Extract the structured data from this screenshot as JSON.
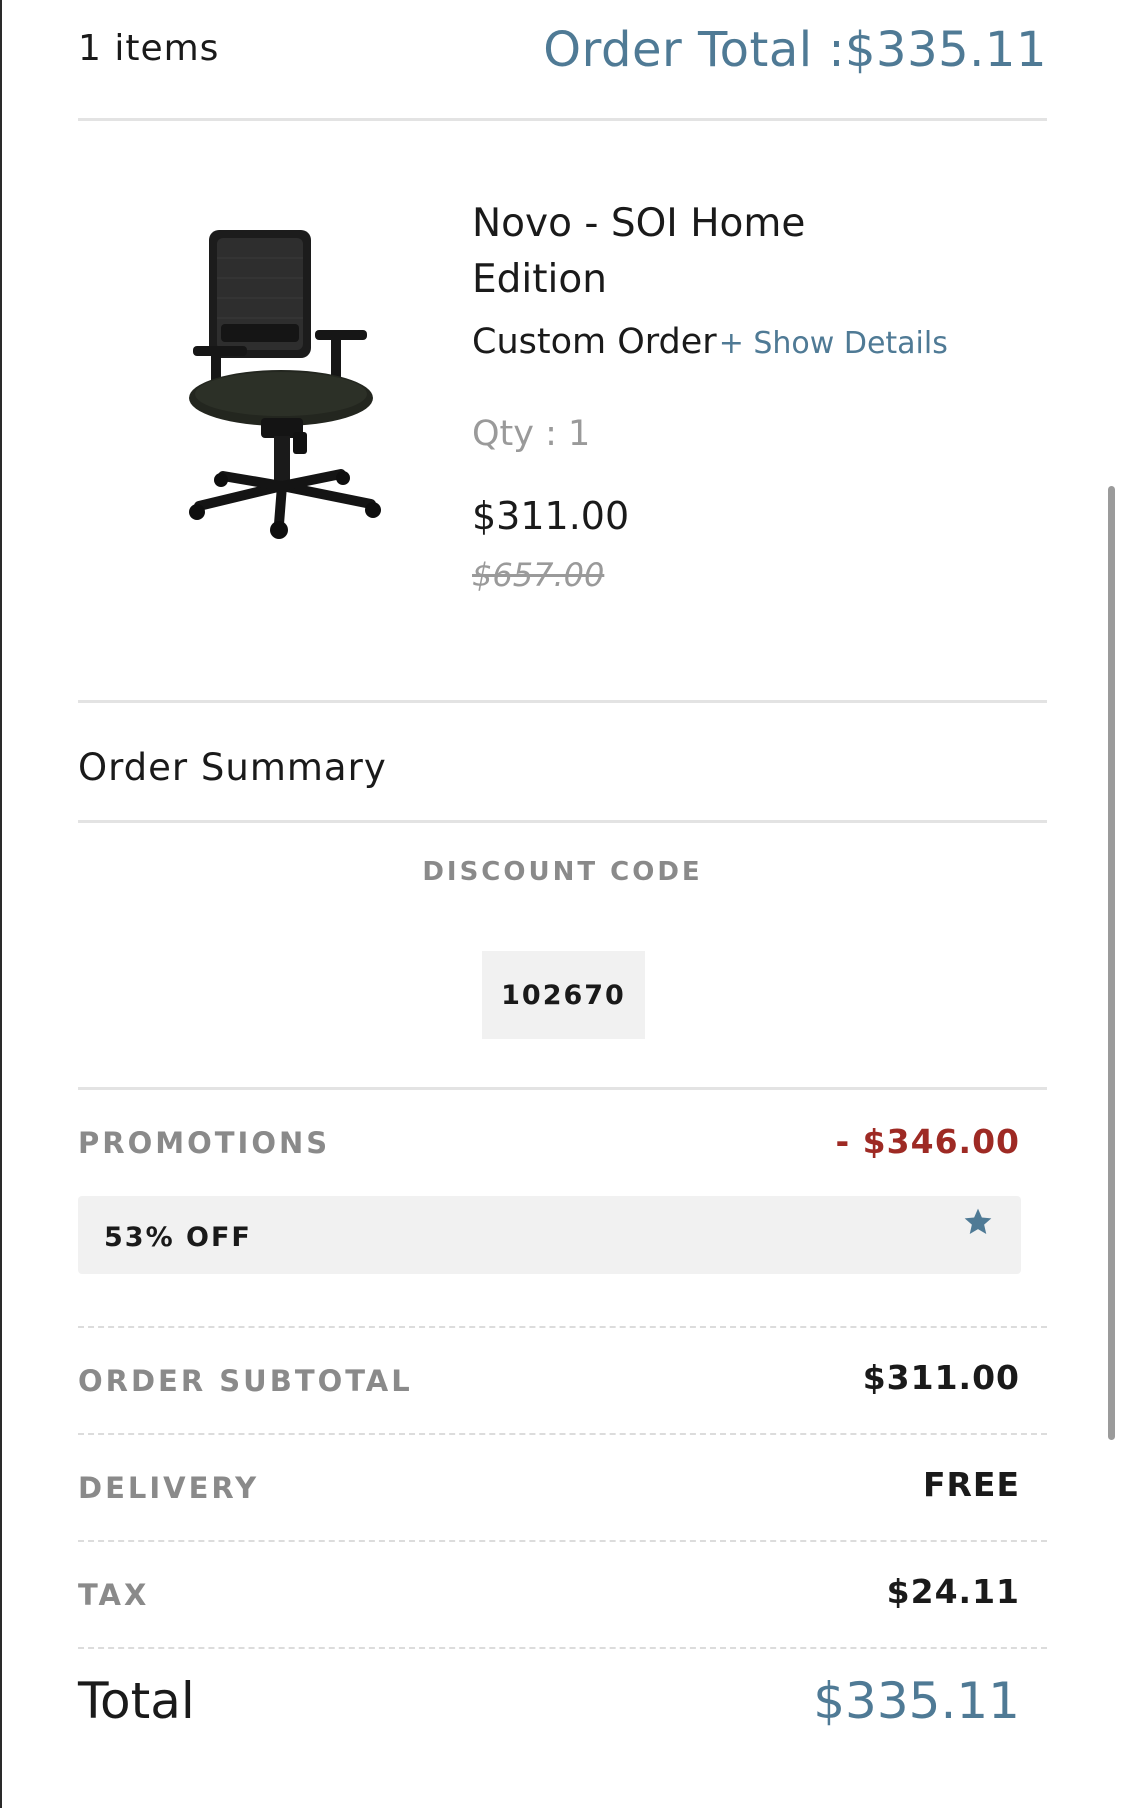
{
  "header": {
    "items_count": "1  items",
    "order_total_label": "Order Total :",
    "order_total_value": "$335.11"
  },
  "product": {
    "name": "Novo - SOI Home Edition",
    "subtitle": "Custom Order",
    "show_details": "+ Show Details",
    "qty": "Qty : 1",
    "price": "$311.00",
    "original_price": "$657.00",
    "image_icon": "office-chair"
  },
  "summary": {
    "title": "Order Summary",
    "discount_label": "DISCOUNT CODE",
    "discount_code": "102670",
    "promotions_label": "PROMOTIONS",
    "promotions_value": "- $346.00",
    "promo_chip": "53% OFF",
    "promo_icon": "star-icon",
    "subtotal_label": "ORDER SUBTOTAL",
    "subtotal_value": "$311.00",
    "delivery_label": "DELIVERY",
    "delivery_value": "FREE",
    "tax_label": "TAX",
    "tax_value": "$24.11",
    "total_label": "Total",
    "total_value": "$335.11"
  },
  "colors": {
    "accent": "#4f7a95",
    "promo_red": "#9e2a24",
    "muted": "#8a8a8a"
  }
}
